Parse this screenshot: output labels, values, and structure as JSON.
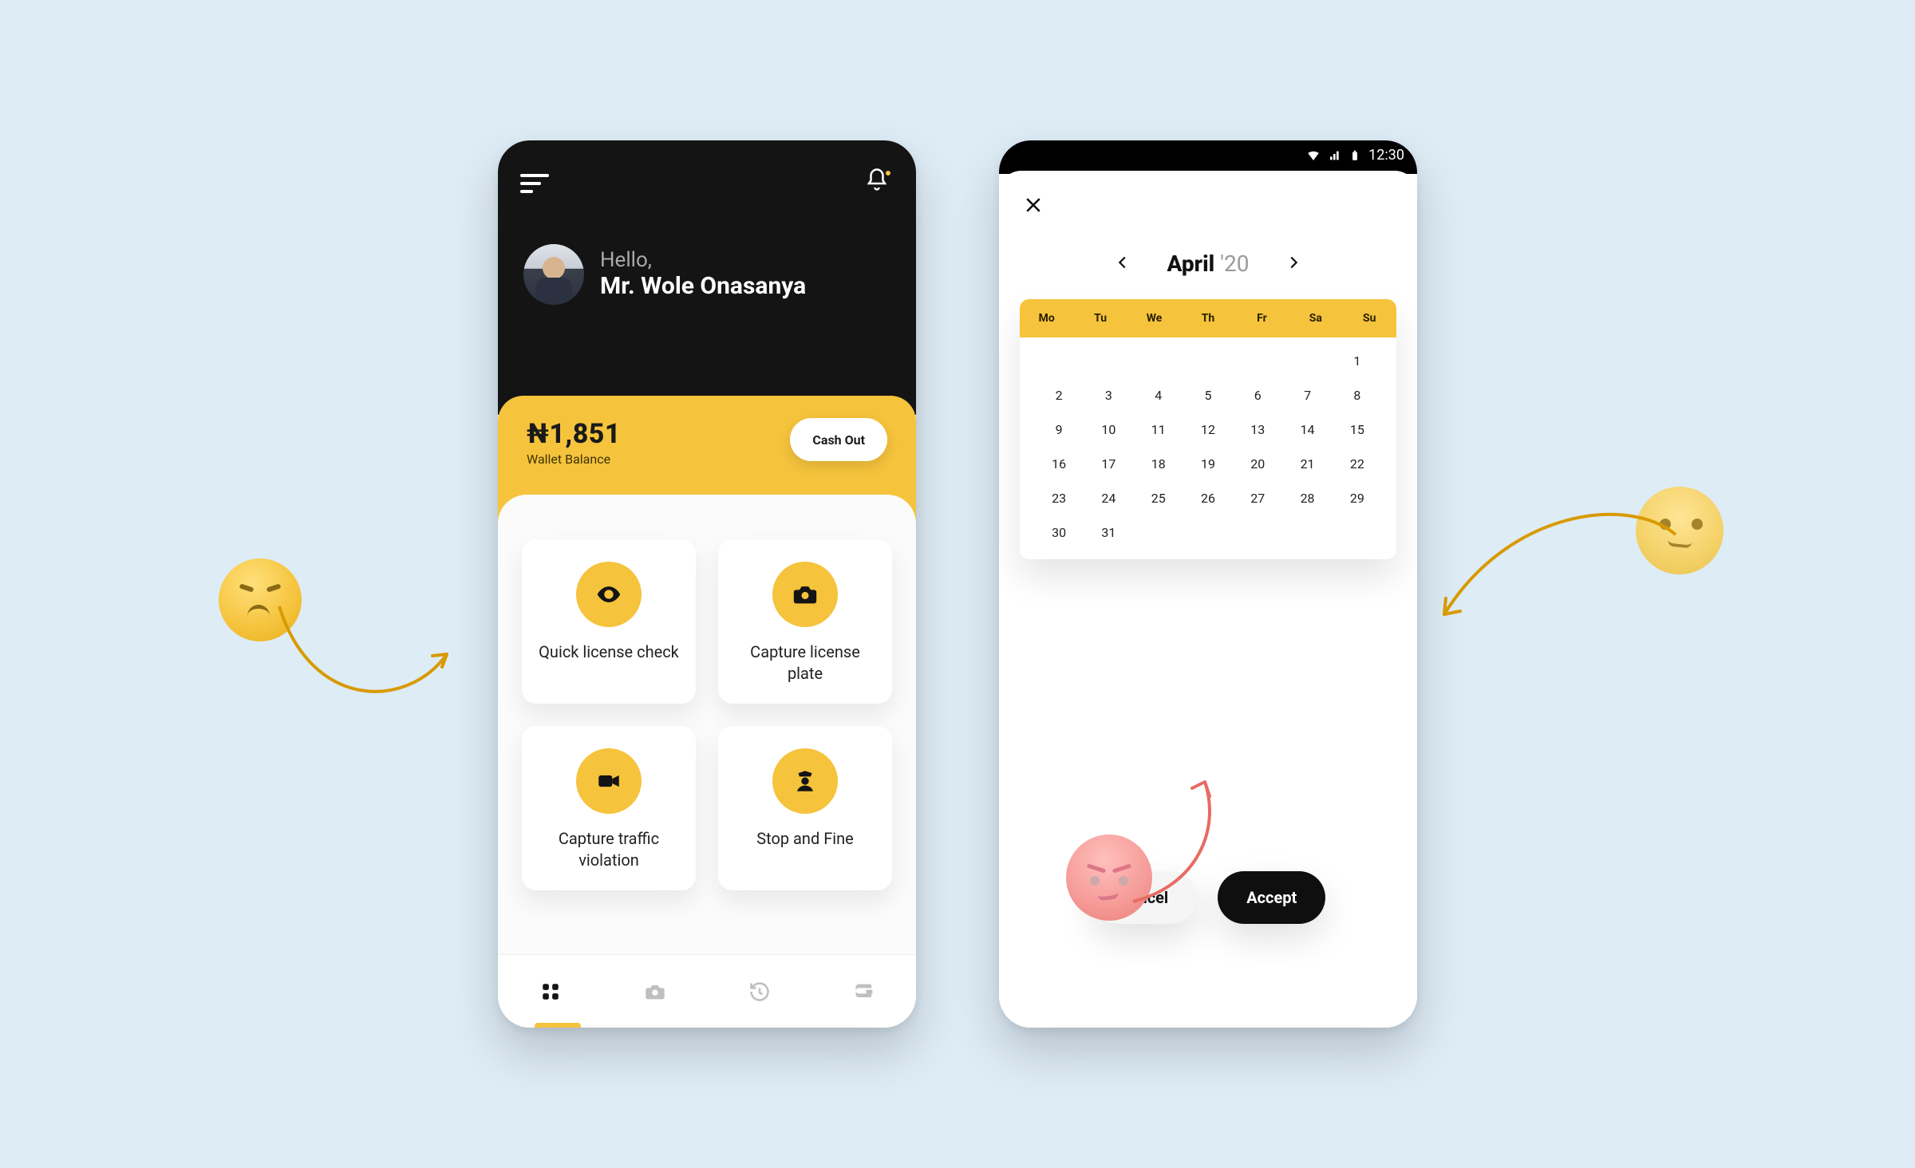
{
  "colors": {
    "accent": "#f5c33c",
    "ink": "#161616",
    "bg": "#deecf6"
  },
  "phoneA": {
    "greeting": "Hello,",
    "user_name": "Mr. Wole Onasanya",
    "wallet": {
      "amount": "₦1,851",
      "label": "Wallet Balance",
      "cashout_label": "Cash Out"
    },
    "tiles": [
      {
        "label": "Quick license check",
        "icon": "eye-icon"
      },
      {
        "label": "Capture license plate",
        "icon": "camera-icon"
      },
      {
        "label": "Capture traffic violation",
        "icon": "video-icon"
      },
      {
        "label": "Stop and Fine",
        "icon": "officer-icon"
      }
    ],
    "tabs": [
      "grid-icon",
      "camera-icon",
      "history-icon",
      "wallet-icon"
    ]
  },
  "phoneB": {
    "status_time": "12:30",
    "month": "April",
    "year_short": "'20",
    "dow": [
      "Mo",
      "Tu",
      "We",
      "Th",
      "Fr",
      "Sa",
      "Su"
    ],
    "first_weekday_index": 6,
    "days_in_month": 30,
    "trailing": [
      31
    ],
    "buttons": {
      "cancel": "Cancel",
      "accept": "Accept"
    }
  }
}
